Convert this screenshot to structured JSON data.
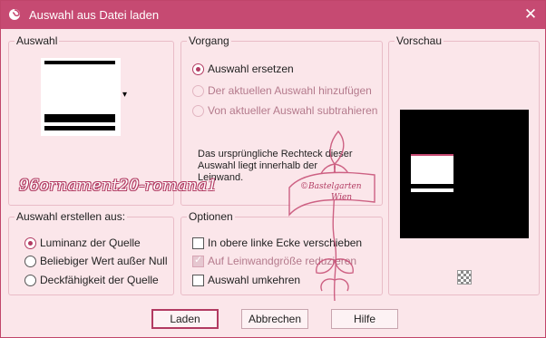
{
  "window": {
    "title": "Auswahl aus Datei laden",
    "close_glyph": "✕",
    "app_icon": "psp-swirl-icon"
  },
  "auswahl": {
    "title": "Auswahl",
    "dropdown_glyph": "▾"
  },
  "vorgang": {
    "title": "Vorgang",
    "options": [
      {
        "label": "Auswahl ersetzen",
        "checked": true,
        "enabled": true
      },
      {
        "label": "Der aktuellen Auswahl hinzufügen",
        "checked": false,
        "enabled": false
      },
      {
        "label": "Von aktueller Auswahl subtrahieren",
        "checked": false,
        "enabled": false
      }
    ],
    "info": "Das ursprüngliche Rechteck dieser Auswahl liegt innerhalb der Leinwand."
  },
  "vorschau": {
    "title": "Vorschau",
    "pan_icon": "pan-checker-icon"
  },
  "erstellen": {
    "title": "Auswahl erstellen aus:",
    "options": [
      {
        "label": "Luminanz der Quelle",
        "checked": true
      },
      {
        "label": "Beliebiger Wert außer Null",
        "checked": false
      },
      {
        "label": "Deckfähigkeit der Quelle",
        "checked": false
      }
    ]
  },
  "optionen": {
    "title": "Optionen",
    "checks": [
      {
        "label": "In obere linke Ecke verschieben",
        "checked": false,
        "enabled": true
      },
      {
        "label": "Auf Leinwandgröße reduzieren",
        "checked": true,
        "enabled": false
      },
      {
        "label": "Auswahl umkehren",
        "checked": false,
        "enabled": true
      }
    ]
  },
  "buttons": {
    "load": "Laden",
    "cancel": "Abbrechen",
    "help": "Hilfe"
  },
  "watermark": {
    "text": "96ornament20-romana1",
    "stamp_line1": "©Bastelgarten",
    "stamp_line2": "Wien"
  },
  "colors": {
    "titlebar": "#c64a72",
    "accent": "#b23b62",
    "background": "#fbe6ea"
  }
}
